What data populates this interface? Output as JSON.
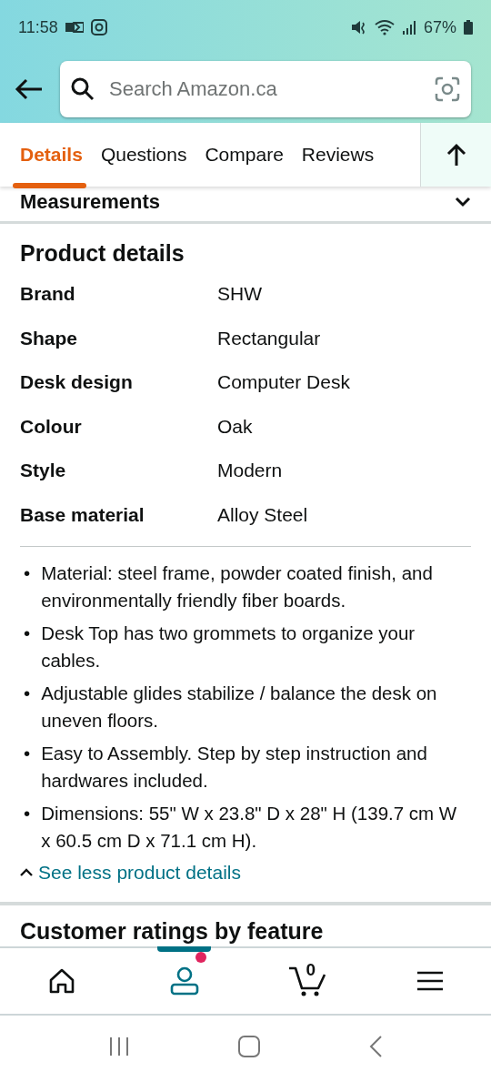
{
  "status_bar": {
    "time": "11:58",
    "battery": "67%"
  },
  "search": {
    "placeholder": "Search Amazon.ca"
  },
  "tabs": [
    {
      "label": "Details",
      "selected": true
    },
    {
      "label": "Questions",
      "selected": false
    },
    {
      "label": "Compare",
      "selected": false
    },
    {
      "label": "Reviews",
      "selected": false
    }
  ],
  "collapsed_section": {
    "title": "Measurements",
    "expanded": false
  },
  "product_details": {
    "title": "Product details",
    "rows": [
      {
        "label": "Brand",
        "value": "SHW"
      },
      {
        "label": "Shape",
        "value": "Rectangular"
      },
      {
        "label": "Desk design",
        "value": "Computer Desk"
      },
      {
        "label": "Colour",
        "value": "Oak"
      },
      {
        "label": "Style",
        "value": "Modern"
      },
      {
        "label": "Base material",
        "value": "Alloy Steel"
      }
    ]
  },
  "bullets": [
    {
      "marker": "•",
      "text": "Material: steel frame, powder coated finish, and environmentally friendly fiber boards."
    },
    {
      "marker": "•",
      "text": "Desk Top has two grommets to organize your cables."
    },
    {
      "marker": "•",
      "text": "Adjustable glides stabilize / balance the desk on uneven floors."
    },
    {
      "marker": "•",
      "text": "Easy to Assembly. Step by step instruction and hardwares included."
    },
    {
      "marker": "•",
      "text": "Dimensions: 55\" W x 23.8\" D x 28\" H (139.7 cm W x 60.5 cm D x 71.1 cm H)."
    }
  ],
  "see_less_link": "See less product details",
  "next_section_title": "Customer ratings by feature",
  "bottom_nav": [
    {
      "kind": "home",
      "selected": false
    },
    {
      "kind": "account",
      "selected": true,
      "notification": true
    },
    {
      "kind": "cart",
      "selected": false,
      "count": "0"
    },
    {
      "kind": "menu",
      "selected": false
    }
  ]
}
